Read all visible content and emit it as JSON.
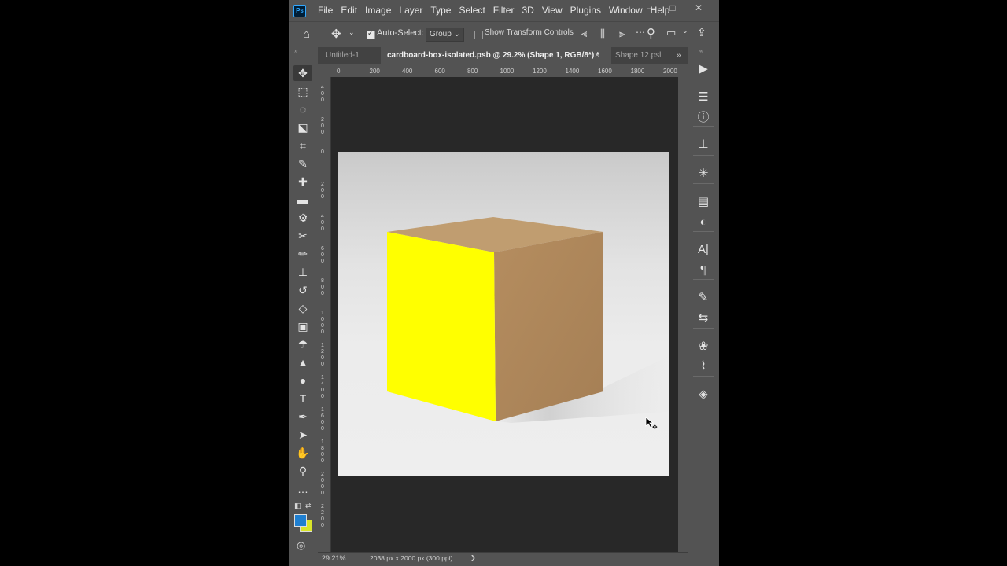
{
  "app": {
    "logo": "Ps",
    "menu": [
      "File",
      "Edit",
      "Image",
      "Layer",
      "Type",
      "Select",
      "Filter",
      "3D",
      "View",
      "Plugins",
      "Window",
      "Help"
    ],
    "window_controls": [
      "—",
      "□",
      "✕"
    ]
  },
  "options_bar": {
    "auto_select_label": "Auto-Select:",
    "auto_select_checked": true,
    "auto_select_value": "Group",
    "show_transform_label": "Show Transform Controls",
    "show_transform_checked": false
  },
  "tabs": [
    {
      "label": "Untitled-1",
      "active": false
    },
    {
      "label": "cardboard-box-isolated.psb @ 29.2% (Shape 1, RGB/8*) *",
      "active": true,
      "close": "×"
    },
    {
      "label": "Shape 12.psl",
      "active": false
    }
  ],
  "tab_overflow": "»",
  "ruler": {
    "h_labels": [
      "0",
      "200",
      "400",
      "600",
      "800",
      "1000",
      "1200",
      "1400",
      "1600",
      "1800",
      "2000"
    ],
    "v_labels": [
      "4\n0\n0",
      "2\n0\n0",
      "0",
      "2\n0\n0",
      "4\n0\n0",
      "6\n0\n0",
      "8\n0\n0",
      "1\n0\n0\n0",
      "1\n2\n0\n0",
      "1\n4\n0\n0",
      "1\n6\n0\n0",
      "1\n8\n0\n0",
      "2\n0\n0\n0",
      "2\n2\n0\n0"
    ]
  },
  "toolbar": {
    "tools": [
      {
        "name": "move-tool",
        "glyph": "✥",
        "active": true
      },
      {
        "name": "marquee-tool",
        "glyph": "⬚"
      },
      {
        "name": "lasso-tool",
        "glyph": "◌"
      },
      {
        "name": "object-select-tool",
        "glyph": "⬕"
      },
      {
        "name": "crop-tool",
        "glyph": "⌗"
      },
      {
        "name": "eyedropper-tool",
        "glyph": "✎"
      },
      {
        "name": "spot-healing-tool",
        "glyph": "✚"
      },
      {
        "name": "healing-brush-tool",
        "glyph": "▬"
      },
      {
        "name": "patch-tool",
        "glyph": "⚙"
      },
      {
        "name": "content-aware-move-tool",
        "glyph": "✂"
      },
      {
        "name": "brush-tool",
        "glyph": "✏"
      },
      {
        "name": "clone-stamp-tool",
        "glyph": "⊥"
      },
      {
        "name": "history-brush-tool",
        "glyph": "↺"
      },
      {
        "name": "eraser-tool",
        "glyph": "◇"
      },
      {
        "name": "gradient-tool",
        "glyph": "▣"
      },
      {
        "name": "blur-tool",
        "glyph": "☂"
      },
      {
        "name": "sharpen-tool",
        "glyph": "▲"
      },
      {
        "name": "dodge-tool",
        "glyph": "●"
      },
      {
        "name": "type-tool",
        "glyph": "T"
      },
      {
        "name": "pen-tool",
        "glyph": "✒"
      },
      {
        "name": "path-select-tool",
        "glyph": "➤"
      },
      {
        "name": "hand-tool",
        "glyph": "✋"
      },
      {
        "name": "zoom-tool",
        "glyph": "⚲"
      },
      {
        "name": "more-tools",
        "glyph": "…"
      }
    ],
    "foreground_color": "#1f7fd0",
    "background_color": "#d9e52a"
  },
  "right_panel": {
    "icons": [
      "play-icon",
      "adjustments-icon",
      "info-icon",
      "stamp-icon",
      "navigator-icon",
      "libraries-icon",
      "color-icon",
      "character-icon",
      "paragraph-icon",
      "brush-settings-icon",
      "sliders-icon",
      "channels-icon",
      "paths-icon",
      "layers-icon"
    ],
    "glyphs": [
      "▶",
      "☰",
      "ⓘ",
      "⊥",
      "✳",
      "▤",
      "◐",
      "A|",
      "¶",
      "✎",
      "⇆",
      "❀",
      "⌇",
      "◈"
    ]
  },
  "canvas": {
    "cube_front_color": "#ffff00",
    "cube_side_color": "#b38c5e",
    "cube_top_color": "#c09d70"
  },
  "status": {
    "zoom": "29.21%",
    "doc_size": "2038 px x 2000 px (300 ppi)",
    "arrow": "❯"
  }
}
